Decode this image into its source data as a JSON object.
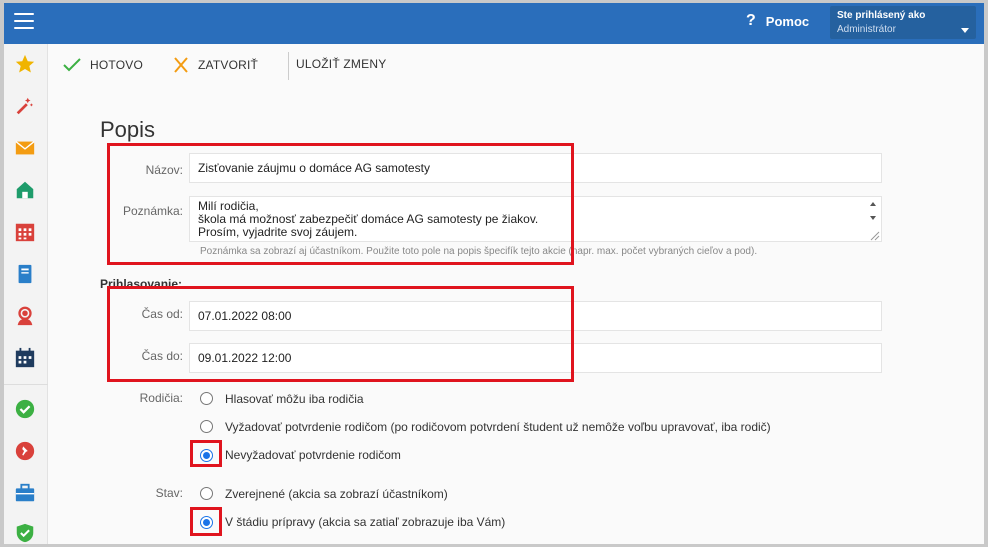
{
  "topbar": {
    "help_label": "Pomoc",
    "user_line1": "Ste prihlásený ako",
    "user_line2": "Administrátor"
  },
  "sidebar": {
    "icons": [
      "star-icon",
      "magic-wand-icon",
      "mail-icon",
      "home-icon",
      "calendar-grid-icon",
      "notebook-icon",
      "user-support-icon",
      "calendar-icon",
      "check-circle-icon",
      "pin-icon",
      "briefcase-icon",
      "shield-check-icon"
    ]
  },
  "toolbar": {
    "done_label": "HOTOVO",
    "close_label": "ZATVORIŤ",
    "save_label": "ULOŽIŤ ZMENY"
  },
  "form": {
    "heading": "Popis",
    "name_label": "Názov:",
    "name_value": "Zisťovanie záujmu o domáce AG samotesty",
    "note_label": "Poznámka:",
    "note_lines": [
      "Milí rodičia,",
      "škola má možnosť zabezpečiť domáce AG samotesty pe žiakov.",
      "Prosím, vyjadrite svoj záujem."
    ],
    "note_hint": "Poznámka sa zobrazí aj účastníkom. Použite toto pole na popis špecifík tejto akcie (napr. max. počet vybraných cieľov a pod).",
    "signup_heading": "Prihlasovanie:",
    "time_from_label": "Čas od:",
    "time_from_value": "07.01.2022 08:00",
    "time_to_label": "Čas do:",
    "time_to_value": "09.01.2022 12:00",
    "parents_label": "Rodičia:",
    "parents_options": [
      "Hlasovať môžu iba rodičia",
      "Vyžadovať potvrdenie rodičom (po rodičovom potvrdení študent už nemôže voľbu upravovať, iba rodič)",
      "Nevyžadovať potvrdenie rodičom"
    ],
    "parents_selected": 2,
    "state_label": "Stav:",
    "state_options": [
      "Zverejnené (akcia sa zobrazí účastníkom)",
      "V štádiu prípravy (akcia sa zatiaľ zobrazuje iba Vám)"
    ],
    "state_selected": 1
  },
  "colors": {
    "topbar": "#2a6ebb",
    "accent_red": "#e0141e",
    "radio_blue": "#1a73e8"
  }
}
